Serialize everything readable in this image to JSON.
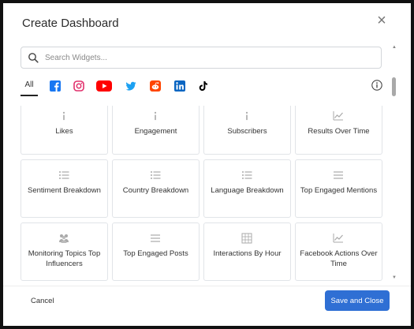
{
  "dialog": {
    "title": "Create Dashboard",
    "close_label": "×"
  },
  "search": {
    "placeholder": "Search Widgets..."
  },
  "tabs": {
    "all_label": "All",
    "platforms": [
      "facebook-icon",
      "instagram-icon",
      "youtube-icon",
      "twitter-icon",
      "reddit-icon",
      "linkedin-icon",
      "tiktok-icon"
    ]
  },
  "widgets": [
    {
      "label": "Likes",
      "icon": "info-icon"
    },
    {
      "label": "Engagement",
      "icon": "info-icon"
    },
    {
      "label": "Subscribers",
      "icon": "info-icon"
    },
    {
      "label": "Results Over Time",
      "icon": "line-chart-icon"
    },
    {
      "label": "Sentiment Breakdown",
      "icon": "list-icon"
    },
    {
      "label": "Country Breakdown",
      "icon": "list-icon"
    },
    {
      "label": "Language Breakdown",
      "icon": "list-icon"
    },
    {
      "label": "Top Engaged Mentions",
      "icon": "lines-icon"
    },
    {
      "label": "Monitoring Topics Top Influencers",
      "icon": "people-icon"
    },
    {
      "label": "Top Engaged Posts",
      "icon": "lines-icon"
    },
    {
      "label": "Interactions By Hour",
      "icon": "grid-icon"
    },
    {
      "label": "Facebook Actions Over Time",
      "icon": "line-chart-icon"
    }
  ],
  "footer": {
    "cancel_label": "Cancel",
    "save_label": "Save and Close"
  },
  "colors": {
    "primary": "#2f6fd4",
    "facebook": "#1877f2",
    "instagram": "#e1306c",
    "youtube": "#ff0000",
    "twitter": "#1da1f2",
    "reddit": "#ff4500",
    "linkedin": "#0a66c2",
    "tiktok": "#000000"
  }
}
